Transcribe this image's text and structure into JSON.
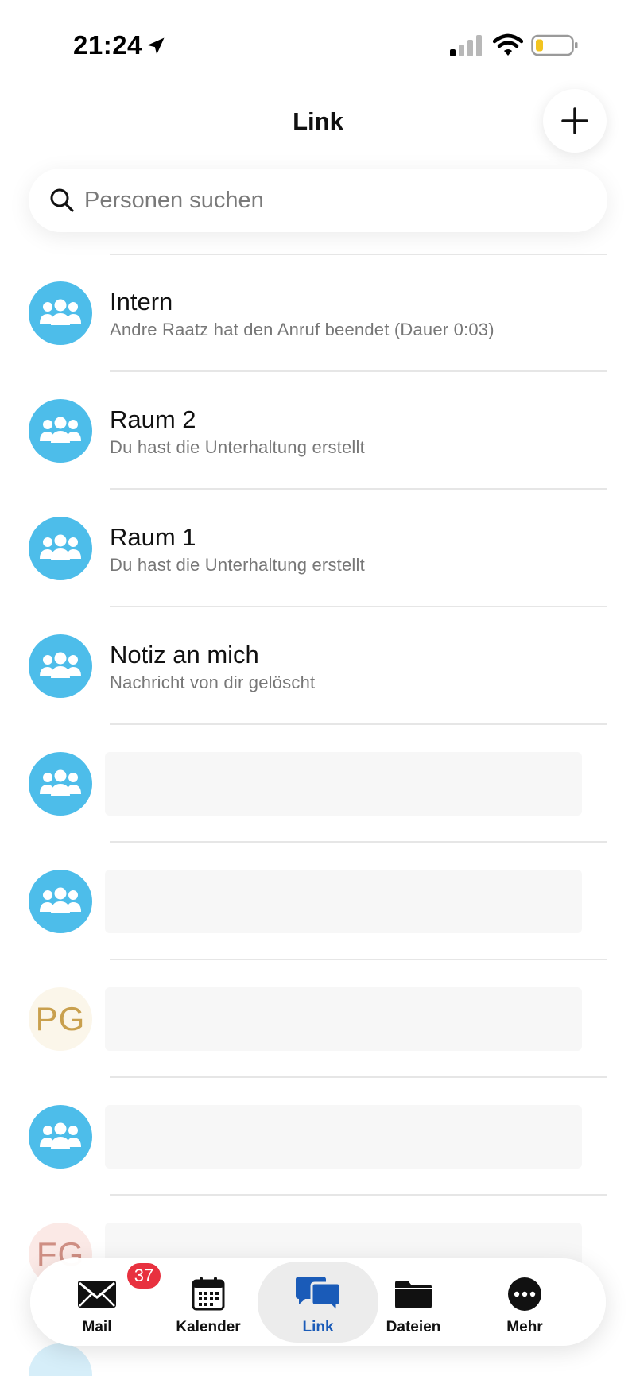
{
  "status_bar": {
    "time": "21:24"
  },
  "header": {
    "title": "Link"
  },
  "search": {
    "placeholder": "Personen suchen"
  },
  "conversations": [
    {
      "title": "Intern",
      "subtitle": "Andre Raatz hat den Anruf beendet (Dauer 0:03)",
      "avatar": "group-icon"
    },
    {
      "title": "Raum 2",
      "subtitle": "Du hast die Unterhaltung erstellt",
      "avatar": "group-icon"
    },
    {
      "title": "Raum 1",
      "subtitle": "Du hast die Unterhaltung erstellt",
      "avatar": "group-icon"
    },
    {
      "title": "Notiz an mich",
      "subtitle": "Nachricht von dir gelöscht",
      "avatar": "group-icon"
    },
    {
      "title": "",
      "subtitle": "",
      "avatar": "group-icon"
    },
    {
      "title": "",
      "subtitle": "",
      "avatar": "group-icon"
    },
    {
      "title": "",
      "subtitle": "",
      "avatar_initials": "PG",
      "avatar_bg": "#fbf6ea",
      "avatar_color": "#c9a04e"
    },
    {
      "title": "",
      "subtitle": "",
      "avatar": "group-icon"
    },
    {
      "title": "",
      "subtitle": "",
      "avatar_initials": "FG",
      "avatar_bg": "#fbe9e6",
      "avatar_color": "#cf8f84"
    }
  ],
  "tabs": [
    {
      "label": "Mail",
      "icon": "mail-icon",
      "badge": "37"
    },
    {
      "label": "Kalender",
      "icon": "calendar-icon"
    },
    {
      "label": "Link",
      "icon": "chat-bubbles-icon",
      "active": true
    },
    {
      "label": "Dateien",
      "icon": "folder-icon"
    },
    {
      "label": "Mehr",
      "icon": "more-icon"
    }
  ],
  "colors": {
    "avatar_blue": "#4dbdea",
    "active_tab": "#1a5bb8",
    "badge_red": "#e8313f"
  }
}
